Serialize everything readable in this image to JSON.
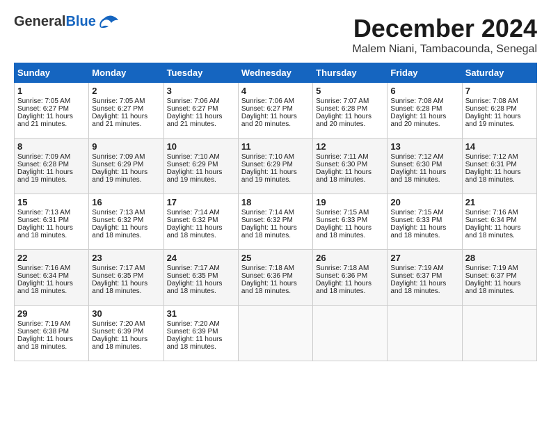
{
  "header": {
    "logo_general": "General",
    "logo_blue": "Blue",
    "month": "December 2024",
    "location": "Malem Niani, Tambacounda, Senegal"
  },
  "weekdays": [
    "Sunday",
    "Monday",
    "Tuesday",
    "Wednesday",
    "Thursday",
    "Friday",
    "Saturday"
  ],
  "weeks": [
    [
      {
        "day": "1",
        "info": "Sunrise: 7:05 AM\nSunset: 6:27 PM\nDaylight: 11 hours and 21 minutes."
      },
      {
        "day": "2",
        "info": "Sunrise: 7:05 AM\nSunset: 6:27 PM\nDaylight: 11 hours and 21 minutes."
      },
      {
        "day": "3",
        "info": "Sunrise: 7:06 AM\nSunset: 6:27 PM\nDaylight: 11 hours and 21 minutes."
      },
      {
        "day": "4",
        "info": "Sunrise: 7:06 AM\nSunset: 6:27 PM\nDaylight: 11 hours and 20 minutes."
      },
      {
        "day": "5",
        "info": "Sunrise: 7:07 AM\nSunset: 6:28 PM\nDaylight: 11 hours and 20 minutes."
      },
      {
        "day": "6",
        "info": "Sunrise: 7:08 AM\nSunset: 6:28 PM\nDaylight: 11 hours and 20 minutes."
      },
      {
        "day": "7",
        "info": "Sunrise: 7:08 AM\nSunset: 6:28 PM\nDaylight: 11 hours and 19 minutes."
      }
    ],
    [
      {
        "day": "8",
        "info": "Sunrise: 7:09 AM\nSunset: 6:28 PM\nDaylight: 11 hours and 19 minutes."
      },
      {
        "day": "9",
        "info": "Sunrise: 7:09 AM\nSunset: 6:29 PM\nDaylight: 11 hours and 19 minutes."
      },
      {
        "day": "10",
        "info": "Sunrise: 7:10 AM\nSunset: 6:29 PM\nDaylight: 11 hours and 19 minutes."
      },
      {
        "day": "11",
        "info": "Sunrise: 7:10 AM\nSunset: 6:29 PM\nDaylight: 11 hours and 19 minutes."
      },
      {
        "day": "12",
        "info": "Sunrise: 7:11 AM\nSunset: 6:30 PM\nDaylight: 11 hours and 18 minutes."
      },
      {
        "day": "13",
        "info": "Sunrise: 7:12 AM\nSunset: 6:30 PM\nDaylight: 11 hours and 18 minutes."
      },
      {
        "day": "14",
        "info": "Sunrise: 7:12 AM\nSunset: 6:31 PM\nDaylight: 11 hours and 18 minutes."
      }
    ],
    [
      {
        "day": "15",
        "info": "Sunrise: 7:13 AM\nSunset: 6:31 PM\nDaylight: 11 hours and 18 minutes."
      },
      {
        "day": "16",
        "info": "Sunrise: 7:13 AM\nSunset: 6:32 PM\nDaylight: 11 hours and 18 minutes."
      },
      {
        "day": "17",
        "info": "Sunrise: 7:14 AM\nSunset: 6:32 PM\nDaylight: 11 hours and 18 minutes."
      },
      {
        "day": "18",
        "info": "Sunrise: 7:14 AM\nSunset: 6:32 PM\nDaylight: 11 hours and 18 minutes."
      },
      {
        "day": "19",
        "info": "Sunrise: 7:15 AM\nSunset: 6:33 PM\nDaylight: 11 hours and 18 minutes."
      },
      {
        "day": "20",
        "info": "Sunrise: 7:15 AM\nSunset: 6:33 PM\nDaylight: 11 hours and 18 minutes."
      },
      {
        "day": "21",
        "info": "Sunrise: 7:16 AM\nSunset: 6:34 PM\nDaylight: 11 hours and 18 minutes."
      }
    ],
    [
      {
        "day": "22",
        "info": "Sunrise: 7:16 AM\nSunset: 6:34 PM\nDaylight: 11 hours and 18 minutes."
      },
      {
        "day": "23",
        "info": "Sunrise: 7:17 AM\nSunset: 6:35 PM\nDaylight: 11 hours and 18 minutes."
      },
      {
        "day": "24",
        "info": "Sunrise: 7:17 AM\nSunset: 6:35 PM\nDaylight: 11 hours and 18 minutes."
      },
      {
        "day": "25",
        "info": "Sunrise: 7:18 AM\nSunset: 6:36 PM\nDaylight: 11 hours and 18 minutes."
      },
      {
        "day": "26",
        "info": "Sunrise: 7:18 AM\nSunset: 6:36 PM\nDaylight: 11 hours and 18 minutes."
      },
      {
        "day": "27",
        "info": "Sunrise: 7:19 AM\nSunset: 6:37 PM\nDaylight: 11 hours and 18 minutes."
      },
      {
        "day": "28",
        "info": "Sunrise: 7:19 AM\nSunset: 6:37 PM\nDaylight: 11 hours and 18 minutes."
      }
    ],
    [
      {
        "day": "29",
        "info": "Sunrise: 7:19 AM\nSunset: 6:38 PM\nDaylight: 11 hours and 18 minutes."
      },
      {
        "day": "30",
        "info": "Sunrise: 7:20 AM\nSunset: 6:39 PM\nDaylight: 11 hours and 18 minutes."
      },
      {
        "day": "31",
        "info": "Sunrise: 7:20 AM\nSunset: 6:39 PM\nDaylight: 11 hours and 18 minutes."
      },
      {
        "day": "",
        "info": ""
      },
      {
        "day": "",
        "info": ""
      },
      {
        "day": "",
        "info": ""
      },
      {
        "day": "",
        "info": ""
      }
    ]
  ]
}
